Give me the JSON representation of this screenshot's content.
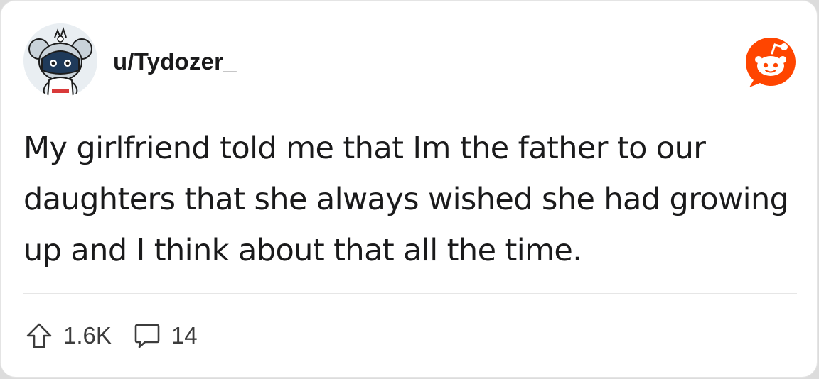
{
  "post": {
    "username": "u/Tydozer_",
    "body": "My girlfriend told me that Im the father to our daughters that she always wished she had growing up and I think about that all the time.",
    "upvotes": "1.6K",
    "comments": "14"
  },
  "icons": {
    "avatar": "snoo-avatar",
    "brand": "reddit-logo-icon",
    "upvote": "upvote-arrow-icon",
    "comment": "comment-bubble-icon"
  },
  "colors": {
    "brand": "#FF4500",
    "text": "#1A1A1B",
    "muted": "#3C3C3C"
  }
}
